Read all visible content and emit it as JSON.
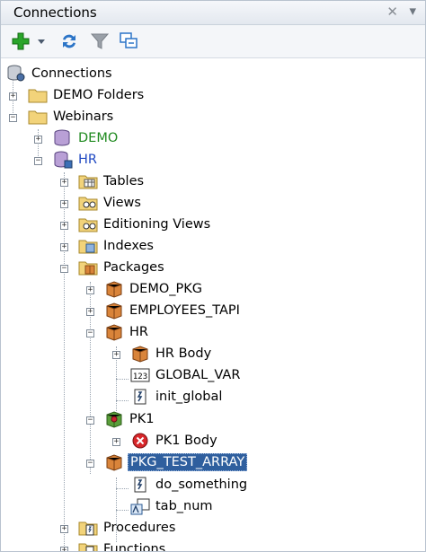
{
  "window": {
    "title": "Connections"
  },
  "toolbar": {
    "buttons": [
      "add-icon",
      "dropdown-arrow-icon",
      "refresh-icon",
      "filter-icon",
      "collapse-icon"
    ]
  },
  "tree": {
    "root": "Connections",
    "items": [
      {
        "label": "DEMO Folders"
      },
      {
        "label": "Webinars"
      },
      {
        "label": "DEMO"
      },
      {
        "label": "HR"
      },
      {
        "label": "Tables"
      },
      {
        "label": "Views"
      },
      {
        "label": "Editioning Views"
      },
      {
        "label": "Indexes"
      },
      {
        "label": "Packages"
      },
      {
        "label": "DEMO_PKG"
      },
      {
        "label": "EMPLOYEES_TAPI"
      },
      {
        "label": "HR"
      },
      {
        "label": "HR Body"
      },
      {
        "label": "GLOBAL_VAR"
      },
      {
        "label": "init_global"
      },
      {
        "label": "PK1"
      },
      {
        "label": "PK1 Body"
      },
      {
        "label": "PKG_TEST_ARRAY"
      },
      {
        "label": "do_something"
      },
      {
        "label": "tab_num"
      },
      {
        "label": "Procedures"
      },
      {
        "label": "Functions"
      }
    ]
  },
  "colors": {
    "selection": "#2f5f9e",
    "connected_label": "#1f8a1f",
    "hr_label": "#1f48c2"
  }
}
